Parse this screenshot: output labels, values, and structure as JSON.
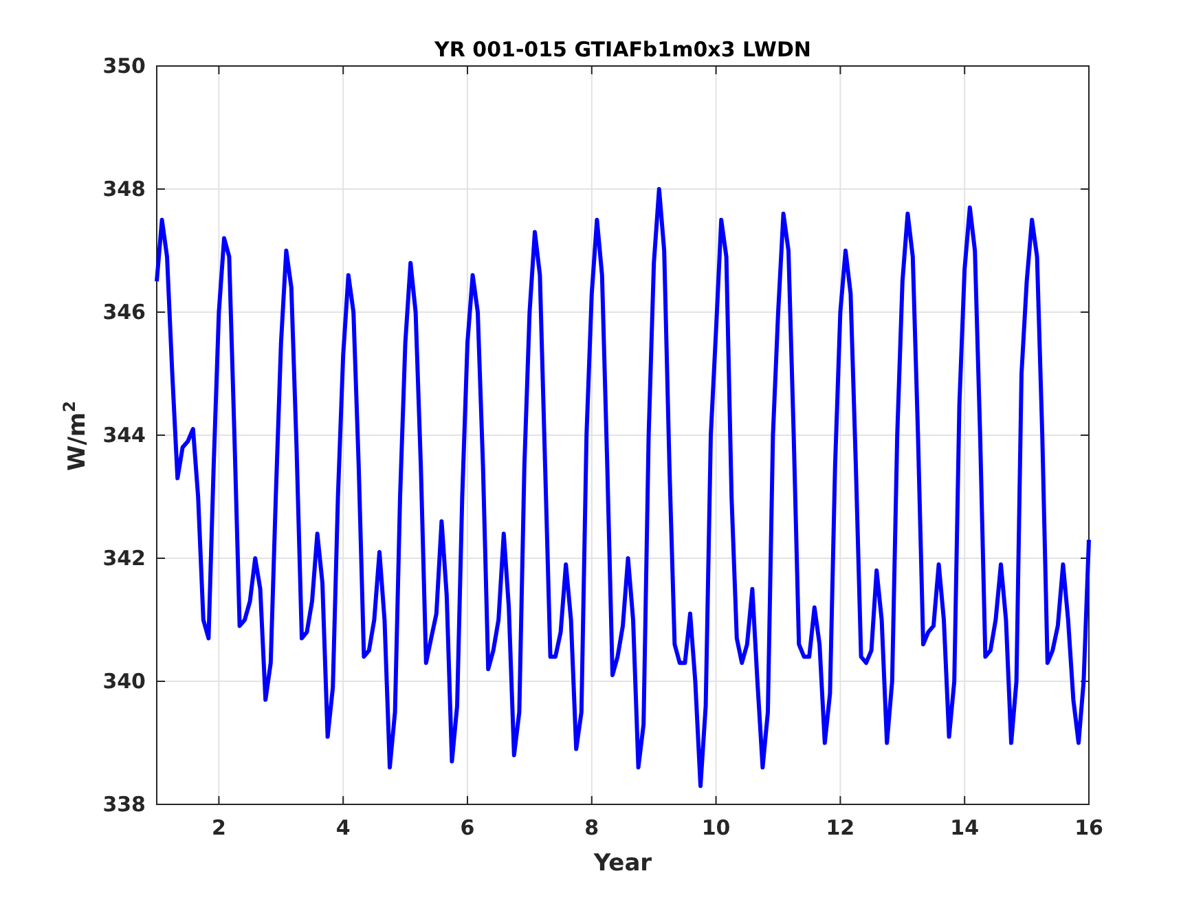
{
  "figure": {
    "chart_data": {
      "type": "line",
      "grid": true,
      "title": "YR 001-015 GTIAFb1m0x3 LWDN",
      "xlabel": "Year",
      "ylabel": "W/m$^{2}$",
      "xlim": [
        1,
        16
      ],
      "ylim": [
        338,
        350
      ],
      "xticks": [
        2,
        4,
        6,
        8,
        10,
        12,
        14,
        16
      ],
      "yticks": [
        338,
        340,
        342,
        344,
        346,
        348,
        350
      ],
      "x": [
        1,
        1.083,
        1.167,
        1.25,
        1.333,
        1.417,
        1.5,
        1.583,
        1.667,
        1.75,
        1.833,
        1.917,
        2,
        2.083,
        2.167,
        2.25,
        2.333,
        2.417,
        2.5,
        2.583,
        2.667,
        2.75,
        2.833,
        2.917,
        3,
        3.083,
        3.167,
        3.25,
        3.333,
        3.417,
        3.5,
        3.583,
        3.667,
        3.75,
        3.833,
        3.917,
        4,
        4.083,
        4.167,
        4.25,
        4.333,
        4.417,
        4.5,
        4.583,
        4.667,
        4.75,
        4.833,
        4.917,
        5,
        5.083,
        5.167,
        5.25,
        5.333,
        5.417,
        5.5,
        5.583,
        5.667,
        5.75,
        5.833,
        5.917,
        6,
        6.083,
        6.167,
        6.25,
        6.333,
        6.417,
        6.5,
        6.583,
        6.667,
        6.75,
        6.833,
        6.917,
        7,
        7.083,
        7.167,
        7.25,
        7.333,
        7.417,
        7.5,
        7.583,
        7.667,
        7.75,
        7.833,
        7.917,
        8,
        8.083,
        8.167,
        8.25,
        8.333,
        8.417,
        8.5,
        8.583,
        8.667,
        8.75,
        8.833,
        8.917,
        9,
        9.083,
        9.167,
        9.25,
        9.333,
        9.417,
        9.5,
        9.583,
        9.667,
        9.75,
        9.833,
        9.917,
        10,
        10.083,
        10.167,
        10.25,
        10.333,
        10.417,
        10.5,
        10.583,
        10.667,
        10.75,
        10.833,
        10.917,
        11,
        11.083,
        11.167,
        11.25,
        11.333,
        11.417,
        11.5,
        11.583,
        11.667,
        11.75,
        11.833,
        11.917,
        12,
        12.083,
        12.167,
        12.25,
        12.333,
        12.417,
        12.5,
        12.583,
        12.667,
        12.75,
        12.833,
        12.917,
        13,
        13.083,
        13.167,
        13.25,
        13.333,
        13.417,
        13.5,
        13.583,
        13.667,
        13.75,
        13.833,
        13.917,
        14,
        14.083,
        14.167,
        14.25,
        14.333,
        14.417,
        14.5,
        14.583,
        14.667,
        14.75,
        14.833,
        14.917,
        15,
        15.083,
        15.167,
        15.25,
        15.333,
        15.417,
        15.5,
        15.583,
        15.667,
        15.75,
        15.833,
        15.917,
        16
      ],
      "series": [
        {
          "color": "#0000ff",
          "values": [
            346.5,
            347.5,
            346.9,
            345.0,
            343.3,
            343.8,
            343.9,
            344.1,
            343.0,
            341.0,
            340.7,
            343.5,
            346.0,
            347.2,
            346.9,
            344.0,
            340.9,
            341.0,
            341.3,
            342.0,
            341.5,
            339.7,
            340.3,
            343.0,
            345.5,
            347.0,
            346.4,
            343.8,
            340.7,
            340.8,
            341.3,
            342.4,
            341.6,
            339.1,
            339.9,
            343.0,
            345.3,
            346.6,
            346.0,
            343.5,
            340.4,
            340.5,
            341.0,
            342.1,
            341.0,
            338.6,
            339.5,
            343.0,
            345.5,
            346.8,
            346.0,
            343.5,
            340.3,
            340.7,
            341.1,
            342.6,
            341.4,
            338.7,
            339.6,
            343.0,
            345.5,
            346.6,
            346.0,
            343.5,
            340.2,
            340.5,
            341.0,
            342.4,
            341.2,
            338.8,
            339.5,
            343.5,
            346.0,
            347.3,
            346.6,
            343.5,
            340.4,
            340.4,
            340.8,
            341.9,
            341.0,
            338.9,
            339.5,
            344.0,
            346.3,
            347.5,
            346.6,
            343.5,
            340.1,
            340.4,
            340.9,
            342.0,
            341.0,
            338.6,
            339.3,
            344.0,
            346.8,
            348.0,
            347.0,
            343.5,
            340.6,
            340.3,
            340.3,
            341.1,
            340.0,
            338.3,
            339.6,
            344.0,
            345.7,
            347.5,
            346.9,
            343.0,
            340.7,
            340.3,
            340.6,
            341.5,
            340.0,
            338.6,
            339.5,
            344.0,
            346.0,
            347.6,
            347.0,
            344.0,
            340.6,
            340.4,
            340.4,
            341.2,
            340.6,
            339.0,
            339.8,
            343.5,
            346.0,
            347.0,
            346.3,
            343.5,
            340.4,
            340.3,
            340.5,
            341.8,
            341.0,
            339.0,
            340.0,
            344.0,
            346.5,
            347.6,
            346.9,
            344.0,
            340.6,
            340.8,
            340.9,
            341.9,
            341.0,
            339.1,
            340.0,
            344.5,
            346.7,
            347.7,
            347.0,
            344.0,
            340.4,
            340.5,
            341.0,
            341.9,
            341.0,
            339.0,
            340.0,
            345.0,
            346.5,
            347.5,
            346.9,
            344.0,
            340.3,
            340.5,
            340.9,
            341.9,
            341.0,
            339.7,
            339.0,
            340.0,
            342.3
          ]
        }
      ]
    }
  }
}
